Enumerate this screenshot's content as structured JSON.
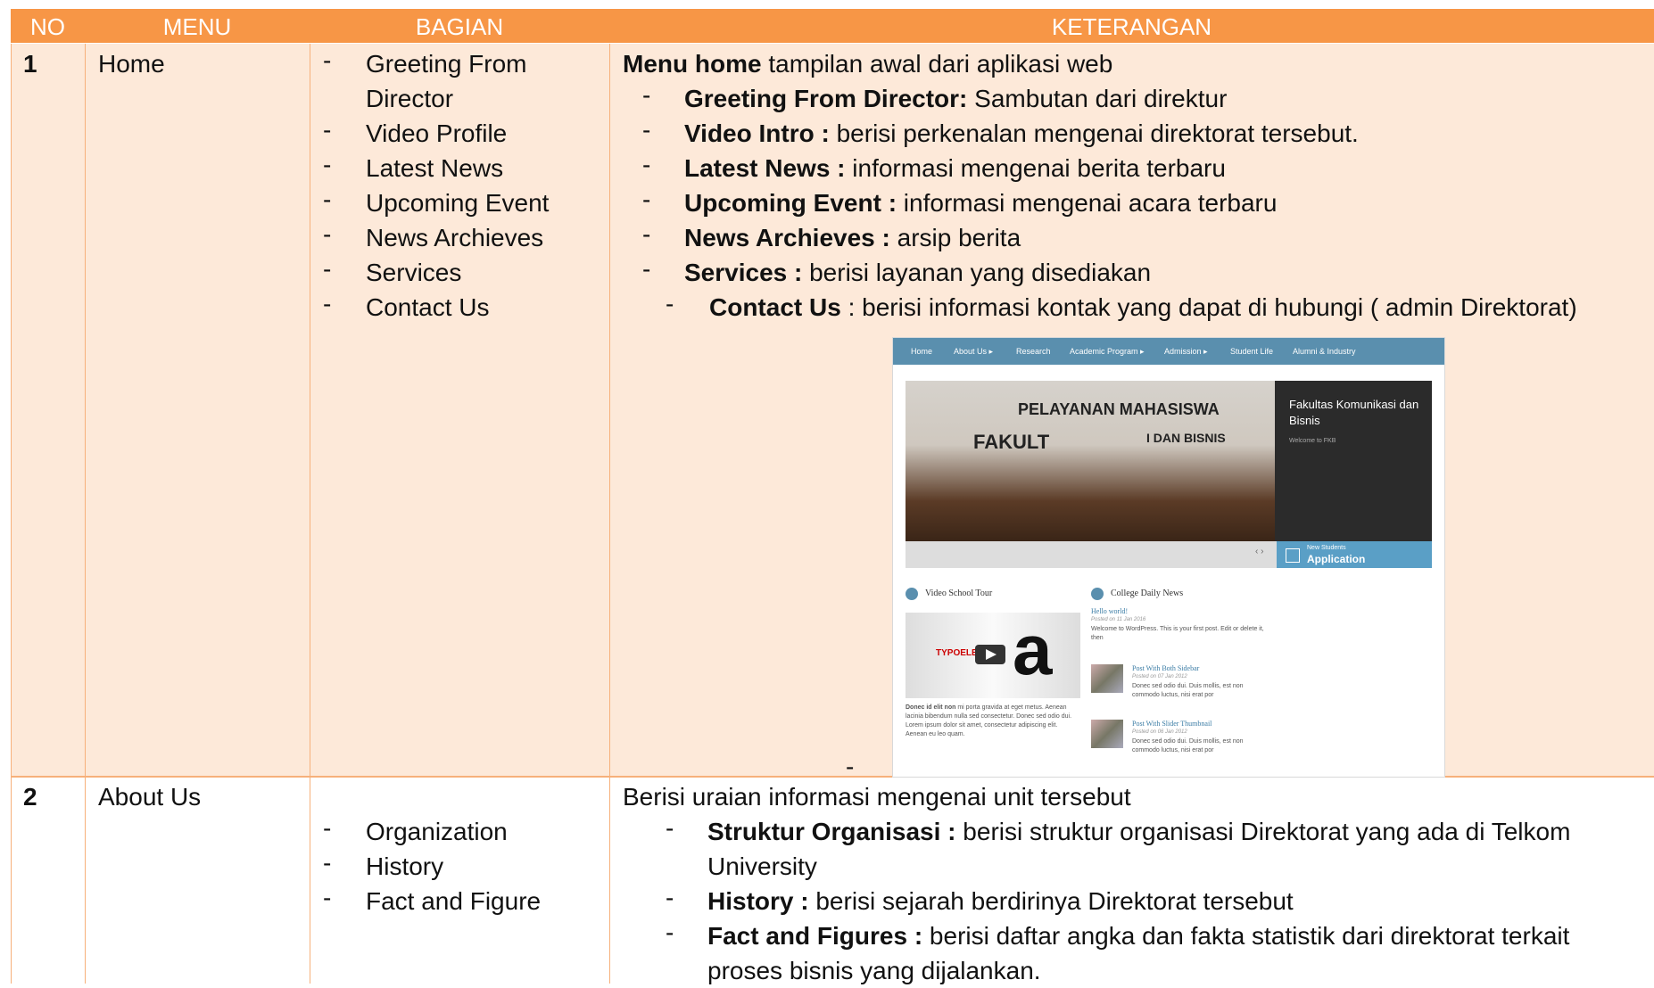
{
  "headers": {
    "no": "NO",
    "menu": "MENU",
    "bagian": "BAGIAN",
    "keterangan": "KETERANGAN"
  },
  "row1": {
    "no": "1",
    "menu": "Home",
    "bagian": [
      "Greeting From",
      "Director",
      "Video Profile",
      "Latest News",
      "Upcoming Event",
      "News Archieves",
      "Services",
      "Contact Us"
    ],
    "intro_bold": "Menu home",
    "intro_rest": " tampilan awal dari aplikasi web",
    "items": [
      {
        "bold": "Greeting From Director:",
        "rest": " Sambutan dari direktur"
      },
      {
        "bold": "Video Intro :",
        "rest": " berisi perkenalan mengenai direktorat tersebut."
      },
      {
        "bold": "Latest News :",
        "rest": " informasi mengenai berita terbaru"
      },
      {
        "bold": "Upcoming Event :",
        "rest": " informasi mengenai acara terbaru"
      },
      {
        "bold": "News Archieves :",
        "rest": " arsip berita"
      },
      {
        "bold": "Services :",
        "rest": "  berisi layanan yang disediakan"
      },
      {
        "bold": "Contact Us",
        "rest": " : berisi informasi kontak yang dapat di hubungi ( admin Direktorat)"
      }
    ],
    "trailing_dash": "-"
  },
  "row2": {
    "no": "2",
    "menu": "About Us",
    "bagian": [
      "Organization",
      "History",
      "Fact and Figure"
    ],
    "intro": "Berisi uraian informasi mengenai unit tersebut",
    "items": [
      {
        "bold": "Struktur Organisasi :",
        "rest": "  berisi struktur organisasi Direktorat yang ada di Telkom",
        "cont": "University"
      },
      {
        "bold": "History :",
        "rest": "  berisi sejarah berdirinya Direktorat  tersebut",
        "cont": ""
      },
      {
        "bold": "Fact and Figures :",
        "rest": " berisi daftar angka dan fakta statistik dari direktorat terkait",
        "cont": "proses bisnis yang dijalankan."
      }
    ]
  },
  "screenshot": {
    "nav": [
      "Home",
      "About Us ▸",
      "Research",
      "Academic Program ▸",
      "Admission ▸",
      "Student Life",
      "Alumni & Industry"
    ],
    "hero_sign1": "PELAYANAN MAHASISWA",
    "hero_sign2": "FAKULT",
    "hero_sign3": "I DAN BISNIS",
    "hero_title": "Fakultas Komunikasi dan Bisnis",
    "hero_sub": "Welcome to FKB",
    "slider_arrows": "‹ ›",
    "app_small": "New Students",
    "app_big": "Application",
    "video_title": "Video School Tour",
    "news_title": "College Daily News",
    "video_brand": "TYPOELEME",
    "video_letter": "a",
    "video_caption_bold": "Donec id elit non",
    "video_caption": " mi porta gravida at eget metus. Aenean lacinia bibendum nulla sed consectetur. Donec sed odio dui. Lorem ipsum dolor sit amet, consectetur adipiscing elit. Aenean eu leo quam.",
    "post1_title": "Hello world!",
    "post1_meta": "Posted on 11 Jan 2016",
    "post1_text": "Welcome to WordPress. This is your first post. Edit or delete it, then",
    "post2_title": "Post With Both Sidebar",
    "post2_meta": "Posted on 07 Jan 2012",
    "post2_text": "Donec sed odio dui. Duis mollis, est non commodo luctus, nisi erat por",
    "post3_title": "Post With Slider Thumbnail",
    "post3_meta": "Posted on 06 Jan 2012",
    "post3_text": "Donec sed odio dui. Duis mollis, est non commodo luctus, nisi erat por"
  }
}
